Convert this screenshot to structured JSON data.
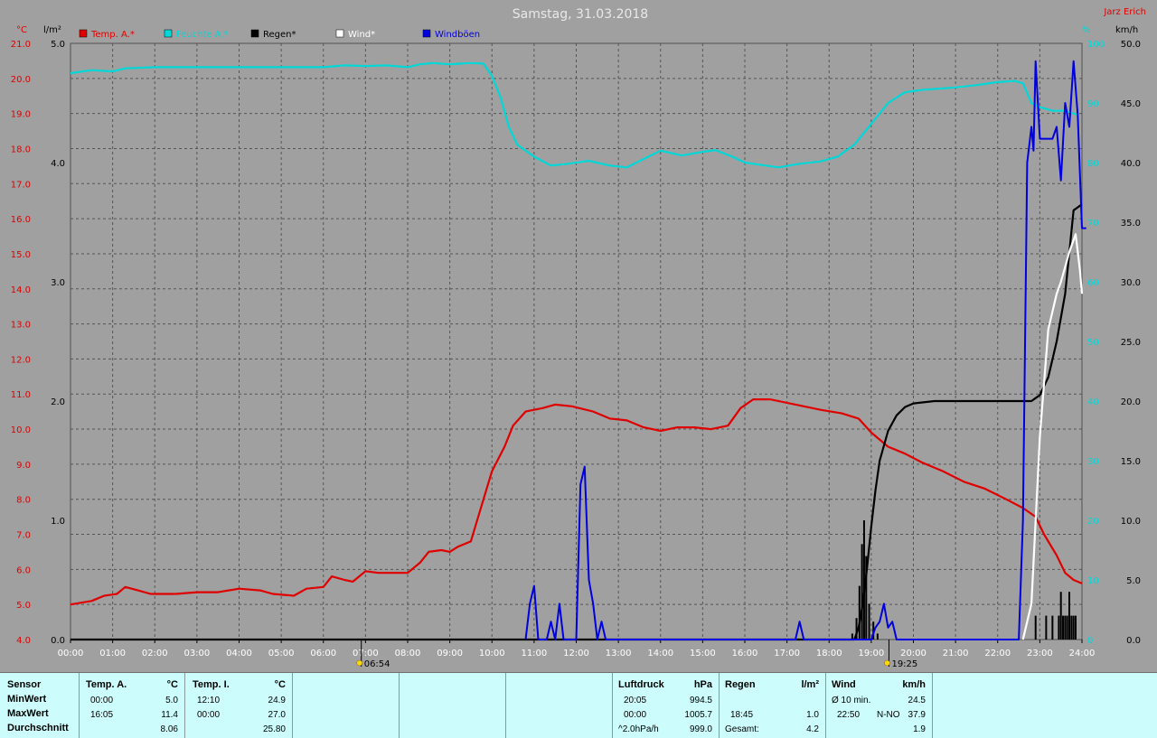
{
  "chart_data": {
    "type": "line",
    "title": "Samstag, 31.03.2018",
    "author": "Jarz Erich",
    "legend": [
      {
        "name": "Temp. A.*",
        "color": "#e00000"
      },
      {
        "name": "Feuchte A.*",
        "color": "#00d8d8"
      },
      {
        "name": "Regen*",
        "color": "#000000"
      },
      {
        "name": "Wind*",
        "color": "#ffffff"
      },
      {
        "name": "Windböen",
        "color": "#0000e0"
      }
    ],
    "axes": {
      "temp_unit": "°C",
      "temp_range": [
        4.0,
        21.0
      ],
      "temp_ticks": [
        "21.0",
        "20.0",
        "19.0",
        "18.0",
        "17.0",
        "16.0",
        "15.0",
        "14.0",
        "13.0",
        "12.0",
        "11.0",
        "10.0",
        "9.0",
        "8.0",
        "7.0",
        "6.0",
        "5.0",
        "4.0"
      ],
      "rain_unit": "l/m²",
      "rain_range": [
        0.0,
        5.0
      ],
      "rain_ticks": [
        "5.0",
        "4.0",
        "3.0",
        "2.0",
        "1.0",
        "0.0"
      ],
      "hum_unit": "%",
      "hum_range": [
        0,
        100
      ],
      "hum_ticks": [
        "100",
        "90",
        "80",
        "70",
        "60",
        "50",
        "40",
        "30",
        "20",
        "10",
        "0"
      ],
      "wind_unit": "km/h",
      "wind_range": [
        0.0,
        50.0
      ],
      "wind_ticks": [
        "50.0",
        "45.0",
        "40.0",
        "35.0",
        "30.0",
        "25.0",
        "20.0",
        "15.0",
        "10.0",
        "5.0",
        "0.0"
      ],
      "x_range": [
        0,
        24
      ],
      "x_ticks": [
        "00:00",
        "01:00",
        "02:00",
        "03:00",
        "04:00",
        "05:00",
        "06:00",
        "07:00",
        "08:00",
        "09:00",
        "10:00",
        "11:00",
        "12:00",
        "13:00",
        "14:00",
        "15:00",
        "16:00",
        "17:00",
        "18:00",
        "19:00",
        "20:00",
        "21:00",
        "22:00",
        "23:00",
        "24:00"
      ]
    },
    "sunrise": {
      "label": "06:54",
      "hour": 6.9
    },
    "sunset": {
      "label": "19:25",
      "hour": 19.42
    },
    "series": [
      {
        "name": "Temp. A.*",
        "axis": "temp",
        "color": "#e00000",
        "points": [
          [
            0,
            5.0
          ],
          [
            0.5,
            5.1
          ],
          [
            0.8,
            5.25
          ],
          [
            1.1,
            5.3
          ],
          [
            1.3,
            5.5
          ],
          [
            1.6,
            5.4
          ],
          [
            1.9,
            5.3
          ],
          [
            2.5,
            5.3
          ],
          [
            3.0,
            5.35
          ],
          [
            3.5,
            5.35
          ],
          [
            4.0,
            5.45
          ],
          [
            4.5,
            5.4
          ],
          [
            4.8,
            5.3
          ],
          [
            5.3,
            5.25
          ],
          [
            5.6,
            5.45
          ],
          [
            6.0,
            5.5
          ],
          [
            6.2,
            5.8
          ],
          [
            6.5,
            5.7
          ],
          [
            6.7,
            5.65
          ],
          [
            7.0,
            5.95
          ],
          [
            7.3,
            5.9
          ],
          [
            7.5,
            5.9
          ],
          [
            8.0,
            5.9
          ],
          [
            8.3,
            6.2
          ],
          [
            8.5,
            6.5
          ],
          [
            8.8,
            6.55
          ],
          [
            9.0,
            6.5
          ],
          [
            9.2,
            6.65
          ],
          [
            9.5,
            6.8
          ],
          [
            9.8,
            8.0
          ],
          [
            10.0,
            8.8
          ],
          [
            10.3,
            9.5
          ],
          [
            10.5,
            10.1
          ],
          [
            10.8,
            10.5
          ],
          [
            11.2,
            10.6
          ],
          [
            11.5,
            10.7
          ],
          [
            11.9,
            10.65
          ],
          [
            12.4,
            10.5
          ],
          [
            12.8,
            10.3
          ],
          [
            13.2,
            10.25
          ],
          [
            13.6,
            10.05
          ],
          [
            14.0,
            9.95
          ],
          [
            14.4,
            10.05
          ],
          [
            14.8,
            10.05
          ],
          [
            15.2,
            10.0
          ],
          [
            15.6,
            10.1
          ],
          [
            15.9,
            10.6
          ],
          [
            16.2,
            10.85
          ],
          [
            16.6,
            10.85
          ],
          [
            17.0,
            10.75
          ],
          [
            17.4,
            10.65
          ],
          [
            17.8,
            10.55
          ],
          [
            18.3,
            10.45
          ],
          [
            18.7,
            10.3
          ],
          [
            19.0,
            9.9
          ],
          [
            19.4,
            9.5
          ],
          [
            19.8,
            9.3
          ],
          [
            20.2,
            9.05
          ],
          [
            20.7,
            8.8
          ],
          [
            21.2,
            8.5
          ],
          [
            21.7,
            8.3
          ],
          [
            22.2,
            8.0
          ],
          [
            22.6,
            7.75
          ],
          [
            22.9,
            7.5
          ],
          [
            23.1,
            7.0
          ],
          [
            23.4,
            6.4
          ],
          [
            23.6,
            5.9
          ],
          [
            23.8,
            5.7
          ],
          [
            24.0,
            5.6
          ]
        ]
      },
      {
        "name": "Feuchte A.*",
        "axis": "hum",
        "color": "#00d8d8",
        "points": [
          [
            0,
            95
          ],
          [
            0.5,
            95.5
          ],
          [
            1.0,
            95.3
          ],
          [
            1.3,
            95.8
          ],
          [
            2,
            96
          ],
          [
            3,
            96
          ],
          [
            4,
            96
          ],
          [
            5,
            96
          ],
          [
            6,
            96
          ],
          [
            6.5,
            96.3
          ],
          [
            7.0,
            96.2
          ],
          [
            7.5,
            96.3
          ],
          [
            8.0,
            96.0
          ],
          [
            8.3,
            96.5
          ],
          [
            8.6,
            96.7
          ],
          [
            9.0,
            96.5
          ],
          [
            9.5,
            96.7
          ],
          [
            9.8,
            96.6
          ],
          [
            10.0,
            94.5
          ],
          [
            10.2,
            91
          ],
          [
            10.4,
            86
          ],
          [
            10.6,
            83
          ],
          [
            11.0,
            81
          ],
          [
            11.4,
            79.5
          ],
          [
            11.8,
            79.8
          ],
          [
            12.3,
            80.3
          ],
          [
            12.8,
            79.5
          ],
          [
            13.2,
            79.2
          ],
          [
            13.6,
            80.6
          ],
          [
            14.0,
            82
          ],
          [
            14.5,
            81.2
          ],
          [
            15.0,
            81.8
          ],
          [
            15.3,
            82.1
          ],
          [
            15.7,
            81
          ],
          [
            16.0,
            80
          ],
          [
            16.5,
            79.5
          ],
          [
            16.8,
            79.2
          ],
          [
            17.3,
            79.8
          ],
          [
            17.8,
            80.2
          ],
          [
            18.2,
            81
          ],
          [
            18.6,
            83
          ],
          [
            19.0,
            86.5
          ],
          [
            19.4,
            90
          ],
          [
            19.8,
            91.8
          ],
          [
            20.2,
            92.2
          ],
          [
            20.6,
            92.4
          ],
          [
            21.0,
            92.6
          ],
          [
            21.5,
            93
          ],
          [
            22.0,
            93.5
          ],
          [
            22.4,
            93.7
          ],
          [
            22.6,
            93.3
          ],
          [
            22.8,
            90
          ],
          [
            23.0,
            89.3
          ],
          [
            23.3,
            88.7
          ],
          [
            23.6,
            88.7
          ],
          [
            23.9,
            88.0
          ]
        ]
      },
      {
        "name": "Regen*",
        "axis": "rain",
        "color": "#000000",
        "points": [
          [
            0,
            0
          ],
          [
            18.6,
            0
          ],
          [
            18.7,
            0.1
          ],
          [
            18.8,
            0.3
          ],
          [
            18.9,
            0.6
          ],
          [
            19.0,
            0.95
          ],
          [
            19.1,
            1.25
          ],
          [
            19.2,
            1.5
          ],
          [
            19.4,
            1.75
          ],
          [
            19.6,
            1.88
          ],
          [
            19.8,
            1.95
          ],
          [
            20.0,
            1.98
          ],
          [
            20.5,
            2.0
          ],
          [
            21,
            2.0
          ],
          [
            22,
            2.0
          ],
          [
            22.8,
            2.0
          ],
          [
            23.0,
            2.05
          ],
          [
            23.2,
            2.2
          ],
          [
            23.4,
            2.5
          ],
          [
            23.6,
            2.9
          ],
          [
            23.8,
            3.6
          ],
          [
            24.0,
            3.65
          ]
        ]
      },
      {
        "name": "Regen* Balken",
        "axis": "rain",
        "color": "#000000",
        "points": [
          [
            18.55,
            0.05
          ],
          [
            18.65,
            0.18
          ],
          [
            18.72,
            0.45
          ],
          [
            18.78,
            0.8
          ],
          [
            18.83,
            1.0
          ],
          [
            18.88,
            0.7
          ],
          [
            18.95,
            0.3
          ],
          [
            19.05,
            0.15
          ],
          [
            19.15,
            0.05
          ],
          [
            22.9,
            0.2
          ],
          [
            23.15,
            0.2
          ],
          [
            23.3,
            0.2
          ],
          [
            23.45,
            0.2
          ],
          [
            23.5,
            0.4
          ],
          [
            23.55,
            0.2
          ],
          [
            23.6,
            0.2
          ],
          [
            23.65,
            0.2
          ],
          [
            23.7,
            0.4
          ],
          [
            23.75,
            0.2
          ],
          [
            23.8,
            0.2
          ],
          [
            23.85,
            0.2
          ]
        ]
      },
      {
        "name": "Wind*",
        "axis": "wind",
        "color": "#ffffff",
        "points": [
          [
            22.6,
            0
          ],
          [
            22.8,
            3
          ],
          [
            23.0,
            17
          ],
          [
            23.2,
            26
          ],
          [
            23.4,
            29
          ],
          [
            23.5,
            30
          ],
          [
            23.7,
            32.5
          ],
          [
            23.85,
            34
          ],
          [
            23.95,
            31
          ],
          [
            24.0,
            29
          ]
        ]
      },
      {
        "name": "Windböen",
        "axis": "wind",
        "color": "#0000e0",
        "points": [
          [
            10.8,
            0
          ],
          [
            10.9,
            3
          ],
          [
            11.0,
            4.5
          ],
          [
            11.1,
            0
          ],
          [
            11.3,
            0
          ],
          [
            11.4,
            1.5
          ],
          [
            11.5,
            0
          ],
          [
            11.6,
            3
          ],
          [
            11.7,
            0
          ],
          [
            12.0,
            0
          ],
          [
            12.1,
            13
          ],
          [
            12.2,
            14.5
          ],
          [
            12.3,
            5
          ],
          [
            12.4,
            3
          ],
          [
            12.5,
            0
          ],
          [
            12.6,
            1.5
          ],
          [
            12.7,
            0
          ],
          [
            17.2,
            0
          ],
          [
            17.3,
            1.5
          ],
          [
            17.4,
            0
          ],
          [
            19.0,
            0
          ],
          [
            19.1,
            1
          ],
          [
            19.2,
            1.5
          ],
          [
            19.3,
            3
          ],
          [
            19.4,
            1
          ],
          [
            19.5,
            1.5
          ],
          [
            19.6,
            0
          ],
          [
            22.5,
            0
          ],
          [
            22.6,
            10
          ],
          [
            22.7,
            40
          ],
          [
            22.8,
            43
          ],
          [
            22.85,
            41
          ],
          [
            22.9,
            48.5
          ],
          [
            23.0,
            42
          ],
          [
            23.3,
            42
          ],
          [
            23.4,
            43
          ],
          [
            23.5,
            38.5
          ],
          [
            23.6,
            45
          ],
          [
            23.7,
            43
          ],
          [
            23.8,
            48.5
          ],
          [
            23.9,
            44
          ],
          [
            24.0,
            34.5
          ],
          [
            24.1,
            34.5
          ]
        ]
      }
    ]
  },
  "stats": {
    "sensor_header": "Sensor",
    "row_labels": [
      "MinWert",
      "MaxWert",
      "Durchschnitt"
    ],
    "temp_a": {
      "title": "Temp. A.",
      "unit": "°C",
      "min_time": "00:00",
      "min": "5.0",
      "max_time": "16:05",
      "max": "11.4",
      "avg": "8.06"
    },
    "temp_i": {
      "title": "Temp. I.",
      "unit": "°C",
      "min_time": "12:10",
      "min": "24.9",
      "max_time": "00:00",
      "max": "27.0",
      "avg": "25.80"
    },
    "pressure": {
      "title": "Luftdruck",
      "unit": "hPa",
      "min_time": "20:05",
      "min": "994.5",
      "max_time": "00:00",
      "max": "1005.7",
      "trend_label": "^2.0hPa/h",
      "trend": "999.0"
    },
    "rain": {
      "title": "Regen",
      "unit": "l/m²",
      "max_time": "18:45",
      "max": "1.0",
      "total_label": "Gesamt:",
      "total": "4.2"
    },
    "wind": {
      "title": "Wind",
      "unit": "km/h",
      "avg_label": "Ø 10 min.",
      "avg": "24.5",
      "max_time": "22:50",
      "max_dir": "N-NO",
      "max": "37.9",
      "avg2": "1.9"
    }
  }
}
